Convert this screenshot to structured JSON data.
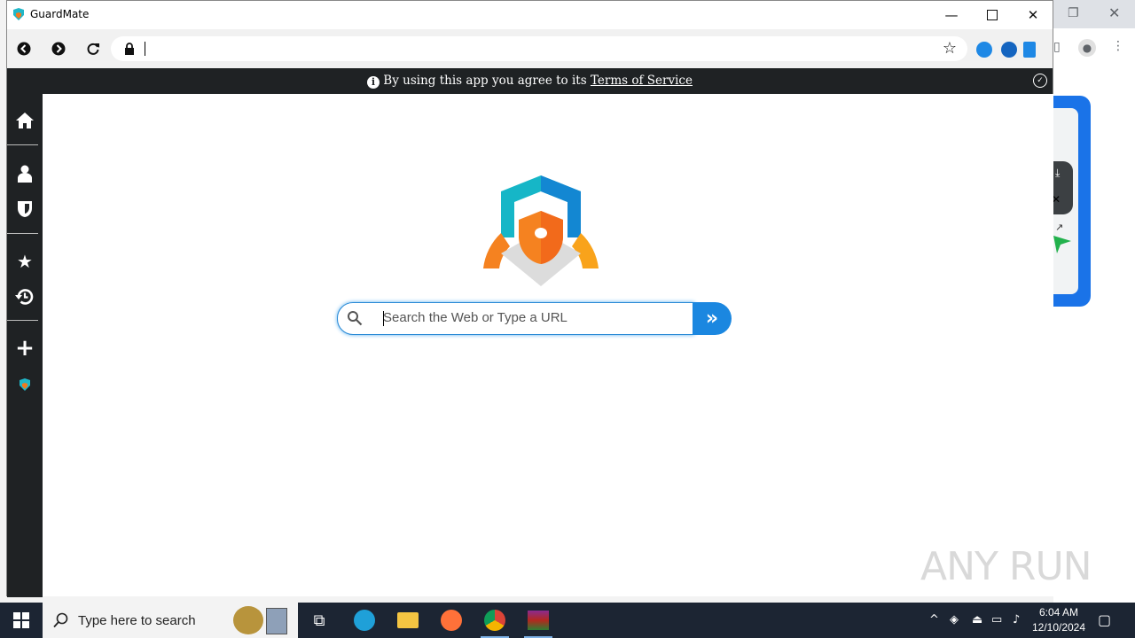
{
  "window": {
    "title": "GuardMate",
    "controls": [
      "minimize",
      "maximize",
      "close"
    ]
  },
  "browser": {
    "url": "",
    "icons": [
      "back-icon",
      "forward-icon",
      "reload-icon",
      "lock-icon",
      "bookmark-star-icon"
    ],
    "extensions": [
      "shield-extension-icon",
      "compass-extension-icon",
      "docs-extension-icon"
    ]
  },
  "notice": {
    "prefix": "By using this app you agree to its ",
    "link": "Terms of Service"
  },
  "sidebar": {
    "items": [
      "home-icon",
      "user-icon",
      "shield-icon",
      "star-icon",
      "history-icon",
      "add-icon",
      "guardmate-icon"
    ]
  },
  "search": {
    "placeholder": "Search the Web or Type a URL",
    "value": ""
  },
  "taskbar": {
    "search_placeholder": "Type here to search",
    "apps": [
      "task-view-icon",
      "edge-icon",
      "file-explorer-icon",
      "firefox-icon",
      "chrome-icon",
      "winrar-icon"
    ],
    "time": "6:04 AM",
    "date": "12/10/2024"
  },
  "watermark": "ANY RUN",
  "colors": {
    "accent": "#1b87e0",
    "dark": "#1f2224",
    "taskbar": "#1c2533"
  }
}
